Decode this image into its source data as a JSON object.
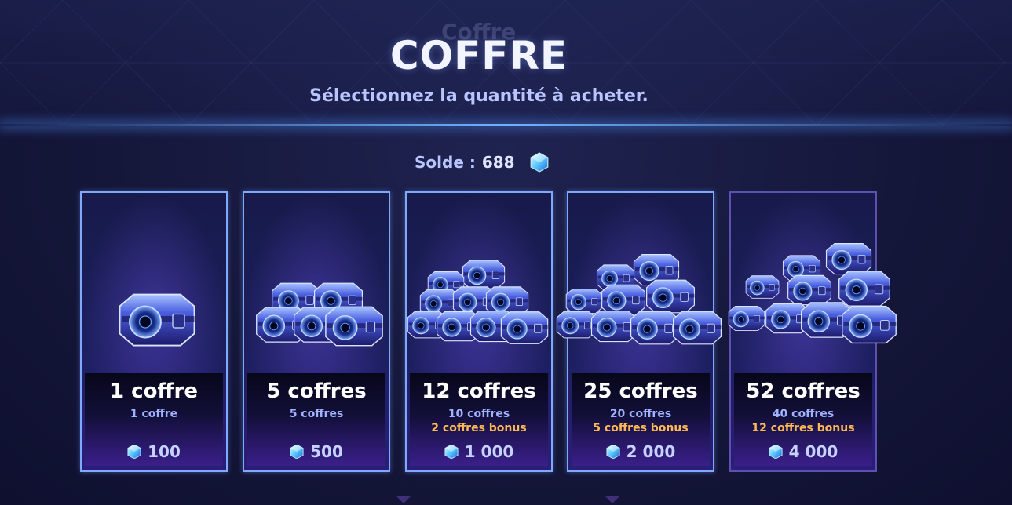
{
  "header": {
    "ghost_title": "Coffre",
    "title": "COFFRE",
    "subtitle": "Sélectionnez la quantité à acheter."
  },
  "balance": {
    "label": "Solde :",
    "value": "688",
    "icon": "gem-icon"
  },
  "colors": {
    "accent": "#7fa9ff",
    "bonus": "#ffba4f",
    "subtext": "#9fb1ff"
  },
  "offers": [
    {
      "title": "1 coffre",
      "detail": "1 coffre",
      "bonus": "",
      "price": "100"
    },
    {
      "title": "5 coffres",
      "detail": "5 coffres",
      "bonus": "",
      "price": "500"
    },
    {
      "title": "12 coffres",
      "detail": "10 coffres",
      "bonus": "2 coffres bonus",
      "price": "1 000"
    },
    {
      "title": "25 coffres",
      "detail": "20 coffres",
      "bonus": "5 coffres bonus",
      "price": "2 000"
    },
    {
      "title": "52 coffres",
      "detail": "40 coffres",
      "bonus": "12 coffres bonus",
      "price": "4 000"
    }
  ]
}
